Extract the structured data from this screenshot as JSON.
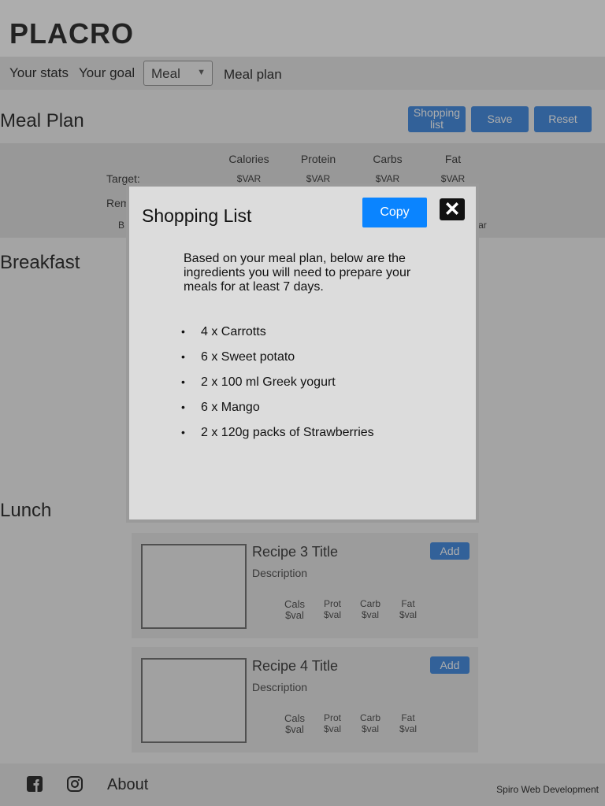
{
  "app": {
    "logo": "PLACRO"
  },
  "nav": {
    "stats": "Your stats",
    "goal": "Your goal",
    "select_value": "Meal",
    "meal_plan": "Meal plan"
  },
  "page": {
    "title": "Meal Plan",
    "shopping_label": "Shopping list",
    "save_label": "Save",
    "reset_label": "Reset"
  },
  "stats": {
    "columns": [
      "Calories",
      "Protein",
      "Carbs",
      "Fat"
    ],
    "target_label": "Target:",
    "target_values": [
      "$VAR",
      "$VAR",
      "$VAR",
      "$VAR"
    ],
    "remaining_label_partial": "Rem",
    "third_label_partial": "B",
    "third_value_partial": "Var"
  },
  "sections": {
    "breakfast": "Breakfast",
    "lunch": "Lunch"
  },
  "recipes": [
    {
      "title": "Recipe 3 Title",
      "description": "Description",
      "add_label": "Add",
      "cals_label": "Cals",
      "cals_value": "$val",
      "prot_label": "Prot",
      "prot_value": "$val",
      "carb_label": "Carb",
      "carb_value": "$val",
      "fat_label": "Fat",
      "fat_value": "$val"
    },
    {
      "title": "Recipe 4 Title",
      "description": "Description",
      "add_label": "Add",
      "cals_label": "Cals",
      "cals_value": "$val",
      "prot_label": "Prot",
      "prot_value": "$val",
      "carb_label": "Carb",
      "carb_value": "$val",
      "fat_label": "Fat",
      "fat_value": "$val"
    }
  ],
  "footer": {
    "facebook_icon": "facebook-icon",
    "instagram_icon": "instagram-icon",
    "about": "About",
    "credit": "Spiro Web Development"
  },
  "modal": {
    "title": "Shopping List",
    "copy_label": "Copy",
    "close_icon": "close-icon",
    "intro": "Based on your meal plan, below are the ingredients you will need to prepare your meals for at least 7 days.",
    "items": [
      "4 x Carrotts",
      "6 x Sweet potato",
      "2 x 100 ml Greek yogurt",
      "6 x Mango",
      "2 x 120g packs of Strawberries"
    ]
  },
  "colors": {
    "accent": "#4a90e2",
    "copy_button": "#0a84ff",
    "overlay": "rgba(0,0,0,0.32)"
  }
}
